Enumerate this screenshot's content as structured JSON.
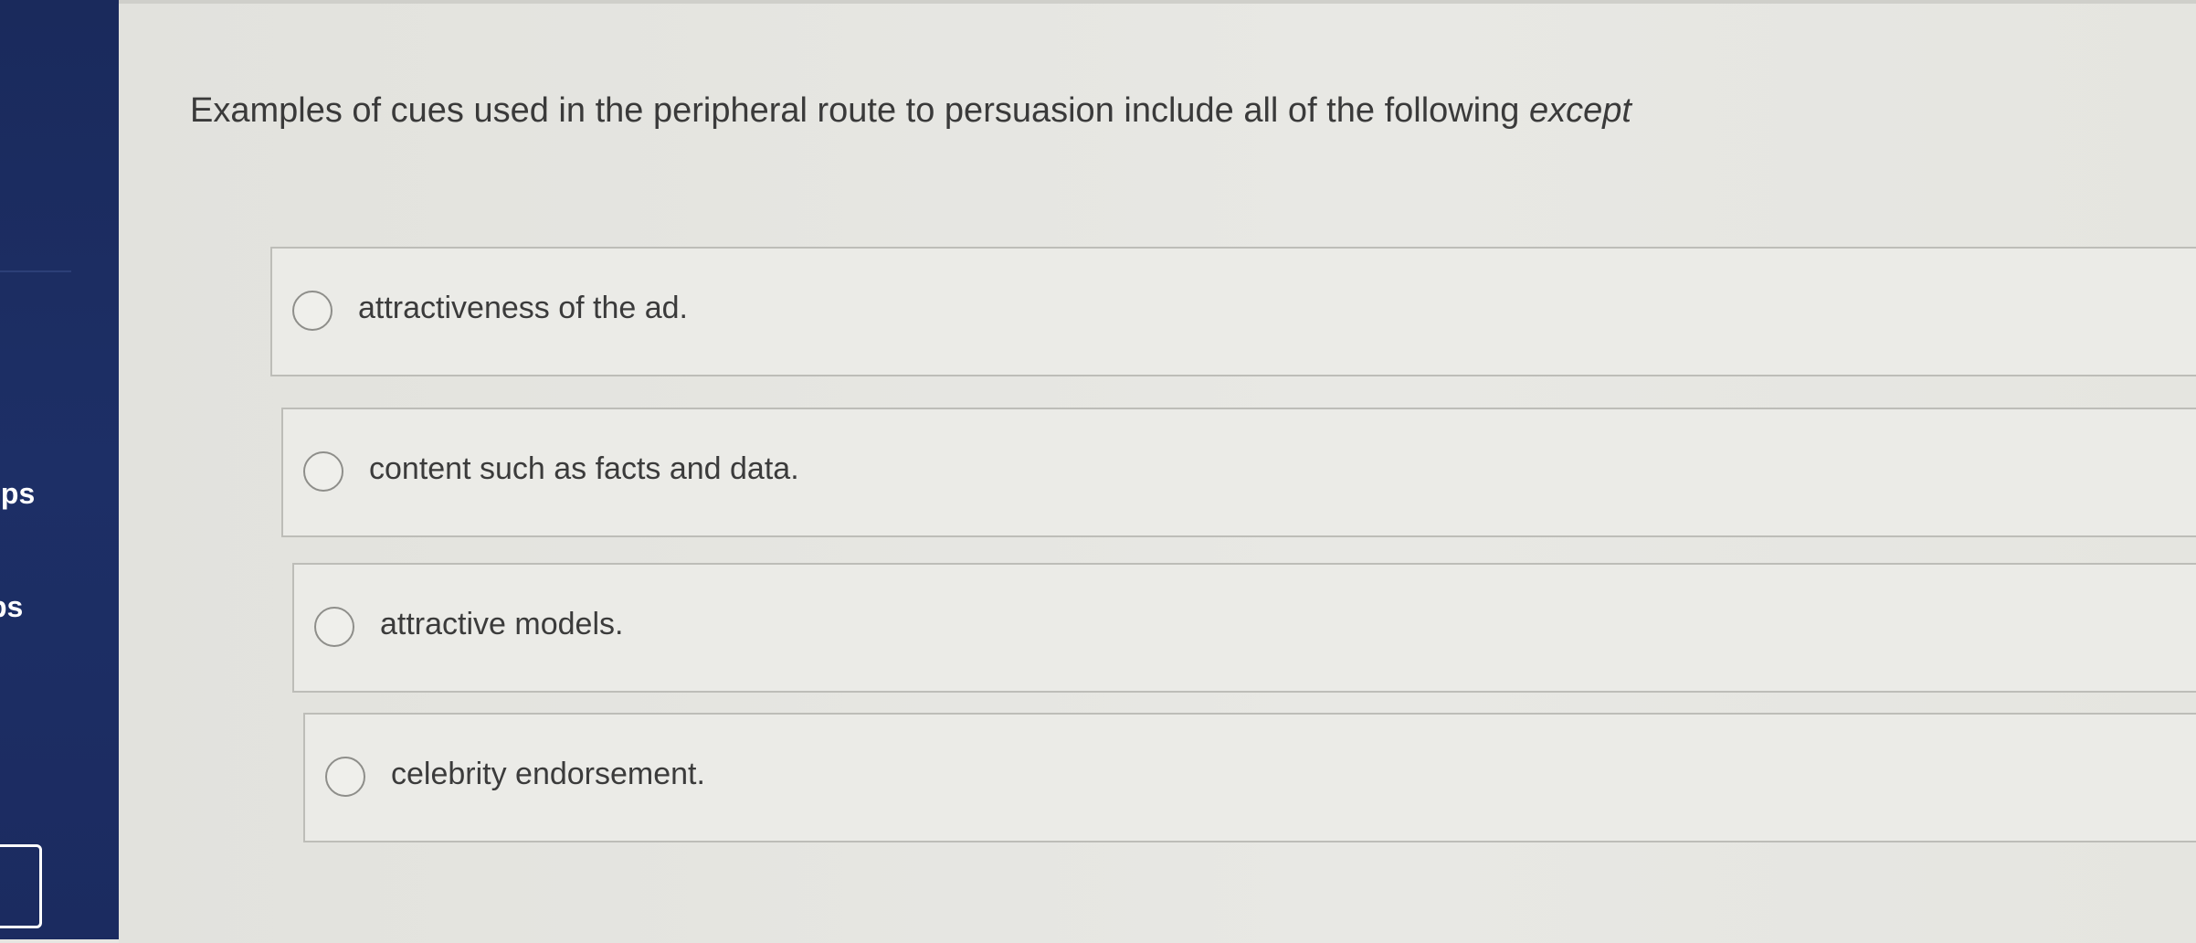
{
  "sidebar": {
    "items": [
      {
        "label": "ips"
      },
      {
        "label": "ps"
      }
    ]
  },
  "question": {
    "text": "Examples of cues used in the peripheral route to persuasion include all of the following",
    "emphasis": "except"
  },
  "options": [
    {
      "label": "attractiveness of the ad."
    },
    {
      "label": "content such as facts and data."
    },
    {
      "label": "attractive models."
    },
    {
      "label": "celebrity endorsement."
    }
  ]
}
